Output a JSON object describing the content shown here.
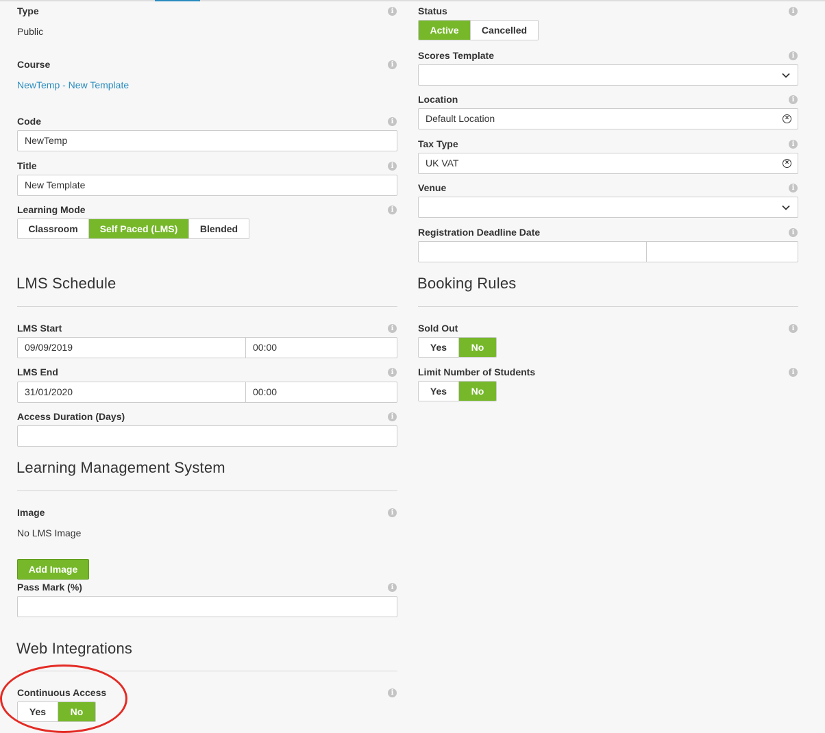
{
  "left": {
    "type": {
      "label": "Type",
      "value": "Public"
    },
    "course": {
      "label": "Course",
      "value": "NewTemp - New Template"
    },
    "code": {
      "label": "Code",
      "value": "NewTemp"
    },
    "title": {
      "label": "Title",
      "value": "New Template"
    },
    "learning_mode": {
      "label": "Learning Mode",
      "options": [
        "Classroom",
        "Self Paced (LMS)",
        "Blended"
      ],
      "selected": "Self Paced (LMS)"
    },
    "lms_schedule": {
      "heading": "LMS Schedule",
      "start": {
        "label": "LMS Start",
        "date": "09/09/2019",
        "time": "00:00"
      },
      "end": {
        "label": "LMS End",
        "date": "31/01/2020",
        "time": "00:00"
      },
      "access_duration": {
        "label": "Access Duration (Days)",
        "value": ""
      }
    },
    "lms": {
      "heading": "Learning Management System",
      "image": {
        "label": "Image",
        "value": "No LMS Image"
      },
      "add_image_button": "Add Image",
      "pass_mark": {
        "label": "Pass Mark (%)",
        "value": ""
      }
    },
    "web_integrations": {
      "heading": "Web Integrations",
      "continuous_access": {
        "label": "Continuous Access",
        "options": [
          "Yes",
          "No"
        ],
        "selected": "No"
      }
    }
  },
  "right": {
    "status": {
      "label": "Status",
      "options": [
        "Active",
        "Cancelled"
      ],
      "selected": "Active"
    },
    "scores_template": {
      "label": "Scores Template",
      "value": ""
    },
    "location": {
      "label": "Location",
      "value": "Default Location"
    },
    "tax_type": {
      "label": "Tax Type",
      "value": "UK VAT"
    },
    "venue": {
      "label": "Venue",
      "value": ""
    },
    "registration_deadline": {
      "label": "Registration Deadline Date",
      "date": "",
      "time": ""
    },
    "booking_rules": {
      "heading": "Booking Rules",
      "sold_out": {
        "label": "Sold Out",
        "options": [
          "Yes",
          "No"
        ],
        "selected": "No"
      },
      "limit_students": {
        "label": "Limit Number of Students",
        "options": [
          "Yes",
          "No"
        ],
        "selected": "No"
      }
    }
  },
  "colors": {
    "accent_green": "#76b82a",
    "link_blue": "#2a8cbf",
    "annotation_red": "#e32b24"
  },
  "icons": {
    "info": "info-icon",
    "clear": "clear-icon",
    "dropdown": "chevron-down-icon"
  }
}
